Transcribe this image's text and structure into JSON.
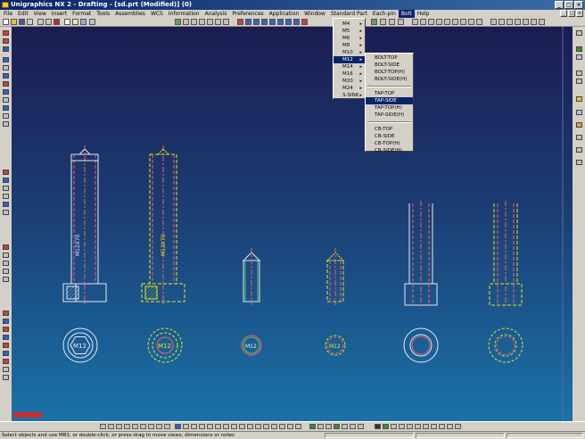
{
  "window": {
    "title": "Unigraphics NX 2 - Drafting - [sd.prt (Modified)]  (0)",
    "controls": [
      "_",
      "□",
      "×"
    ]
  },
  "menu": {
    "items": [
      "File",
      "Edit",
      "View",
      "Insert",
      "Format",
      "Tools",
      "Assemblies",
      "WCS",
      "Information",
      "Analysis",
      "Preferences",
      "Application",
      "Window",
      "Standard Part",
      "Each-pin",
      "Bolt",
      "Help"
    ],
    "active": "Bolt",
    "doc_controls": [
      "_",
      "□",
      "×"
    ]
  },
  "bolt_menu": {
    "items": [
      "M4",
      "M5",
      "M6",
      "M8",
      "M10",
      "M12",
      "M14",
      "M16",
      "M20",
      "M24",
      "S-SINK"
    ],
    "highlighted": "M12"
  },
  "m12_submenu": {
    "groups": [
      [
        "BOLT-TOP",
        "BOLT-SIDE",
        "BOLT-TOP(H)",
        "BOLT-SIDE(H)"
      ],
      [
        "TAP-TOP",
        "TAP-SIDE",
        "TAP-TOP(H)",
        "TAP-SIDE(H)"
      ],
      [
        "CB-TOP",
        "CB-SIDE",
        "CB-TOP(H)",
        "CB-SIDE(H)"
      ]
    ],
    "highlighted": "TAP-SIDE"
  },
  "drawing": {
    "bolt_side_label": "M12X70",
    "top_view_label": "M12",
    "colors": {
      "white": "#e8e8f0",
      "yellow": "#e6e61a",
      "red": "#ff5a5a"
    }
  },
  "status": {
    "text": "Select objects and use MB3, or double-click, or press-drag to move views, dimensions or notes"
  }
}
